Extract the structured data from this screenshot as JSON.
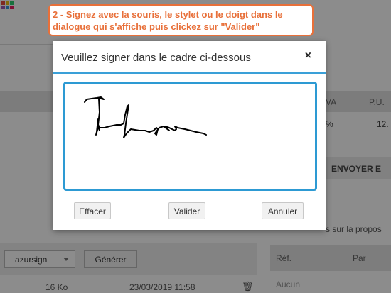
{
  "callout": {
    "line1": "2 - Signez avec la souris, le stylet ou le doigt dans le",
    "line2": "dialogue qui s'affiche puis clickez sur \"Valider\""
  },
  "dialog": {
    "title": "Veuillez signer dans le cadre ci-dessous",
    "close_glyph": "×",
    "buttons": {
      "clear": "Effacer",
      "validate": "Valider",
      "cancel": "Annuler"
    }
  },
  "background": {
    "table": {
      "col_tva": "VA",
      "col_pu": "P.U.",
      "cell_tva": "%",
      "cell_pu": "12."
    },
    "send_button": "ENVOYER E",
    "proposal_text": "s sur la propos",
    "toolbar": {
      "select_value": "azursign",
      "generate_button": "Générer"
    },
    "file_row": {
      "size": "16 Ko",
      "date": "23/03/2019 11:58"
    },
    "panel": {
      "col_ref": "Réf.",
      "col_by": "Par",
      "empty": "Aucun"
    }
  },
  "colors": {
    "accent_orange": "#e8703a",
    "accent_blue": "#2d9ad3"
  }
}
